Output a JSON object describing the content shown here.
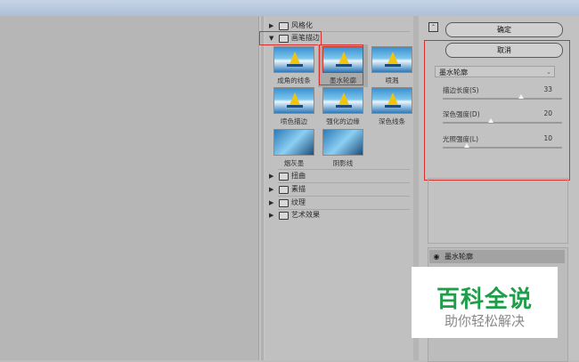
{
  "gallery": {
    "folders_top": [
      {
        "label": "风格化",
        "expanded": false
      },
      {
        "label": "画笔描边",
        "expanded": true
      }
    ],
    "thumbs": [
      {
        "label": "成角的线条"
      },
      {
        "label": "墨水轮廓"
      },
      {
        "label": "喷溅"
      },
      {
        "label": "喷色描边"
      },
      {
        "label": "强化的边缘"
      },
      {
        "label": "深色线条"
      },
      {
        "label": "烟灰墨"
      },
      {
        "label": "阴影线"
      }
    ],
    "folders_bottom": [
      {
        "label": "扭曲"
      },
      {
        "label": "素描"
      },
      {
        "label": "纹理"
      },
      {
        "label": "艺术效果"
      }
    ]
  },
  "panel": {
    "ok_label": "确定",
    "cancel_label": "取消",
    "filter_selected": "墨水轮廓",
    "params": [
      {
        "label": "描边长度(S)",
        "value": "33",
        "fraction": 0.66
      },
      {
        "label": "深色强度(D)",
        "value": "20",
        "fraction": 0.4
      },
      {
        "label": "光照强度(L)",
        "value": "10",
        "fraction": 0.2
      }
    ],
    "layer_name": "墨水轮廓"
  },
  "watermark": {
    "title": "百科全说",
    "subtitle": "助你轻松解决"
  },
  "colors": {
    "highlight_box": "#d9302f",
    "watermark_green": "#1f9e4a"
  },
  "icons": {
    "collapse": "collapse-icon",
    "folder": "folder-icon",
    "eye": "eye-icon"
  }
}
